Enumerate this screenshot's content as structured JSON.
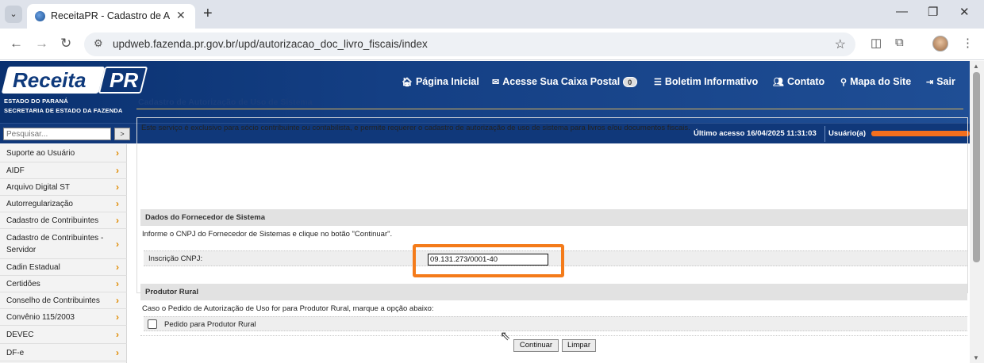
{
  "browser": {
    "tab_title": "ReceitaPR - Cadastro de Autoriz",
    "url": "updweb.fazenda.pr.gov.br/upd/autorizacao_doc_livro_fiscais/index"
  },
  "header": {
    "logo_main": "Receita",
    "logo_pr": "PR",
    "logo_sub1": "ESTADO DO PARANÁ",
    "logo_sub2": "SECRETARIA DE ESTADO DA FAZENDA",
    "nav": {
      "home": "Página Inicial",
      "mailbox": "Acesse Sua Caixa Postal",
      "mailbox_count": "0",
      "bulletin": "Boletim Informativo",
      "contact": "Contato",
      "sitemap": "Mapa do Site",
      "exit": "Sair"
    }
  },
  "subbar": {
    "search_placeholder": "Pesquisar...",
    "search_button": ">",
    "last_access": "Último acesso 16/04/2025 11:31:03",
    "user_label": "Usuário(a)"
  },
  "sidebar": {
    "items": [
      {
        "label": "Suporte ao Usuário"
      },
      {
        "label": "AIDF"
      },
      {
        "label": "Arquivo Digital ST"
      },
      {
        "label": "Autorregularização"
      },
      {
        "label": "Cadastro de Contribuintes"
      },
      {
        "label": "Cadastro de Contribuintes - Servidor"
      },
      {
        "label": "Cadin Estadual"
      },
      {
        "label": "Certidões"
      },
      {
        "label": "Conselho de Contribuintes"
      },
      {
        "label": "Convênio 115/2003"
      },
      {
        "label": "DEVEC"
      },
      {
        "label": "DF-e"
      }
    ]
  },
  "main": {
    "title": "Cadastro de Autorização de Uso de Sistema",
    "description": "Este serviço é exclusivo para sócio contribuinte ou contabilista, e permite requerer o cadastro de autorização de uso de sistema para livros e/ou documentos fiscais.",
    "section1": {
      "heading": "Dados do Fornecedor de Sistema",
      "instruction": "Informe o CNPJ do Fornecedor de Sistemas e clique no botão \"Continuar\".",
      "cnpj_label": "Inscrição CNPJ:",
      "cnpj_value": "09.131.273/0001-40"
    },
    "section2": {
      "heading": "Produtor Rural",
      "instruction": "Caso o Pedido de Autorização de Uso for para Produtor Rural, marque a opção abaixo:",
      "checkbox_label": "Pedido para Produtor Rural"
    },
    "buttons": {
      "continue": "Continuar",
      "clear": "Limpar"
    }
  },
  "colors": {
    "header_blue": "#0a3170",
    "highlight_orange": "#f47b1a",
    "sidebar_chevron": "#e08b00",
    "title_blue": "#1a3f7d"
  }
}
